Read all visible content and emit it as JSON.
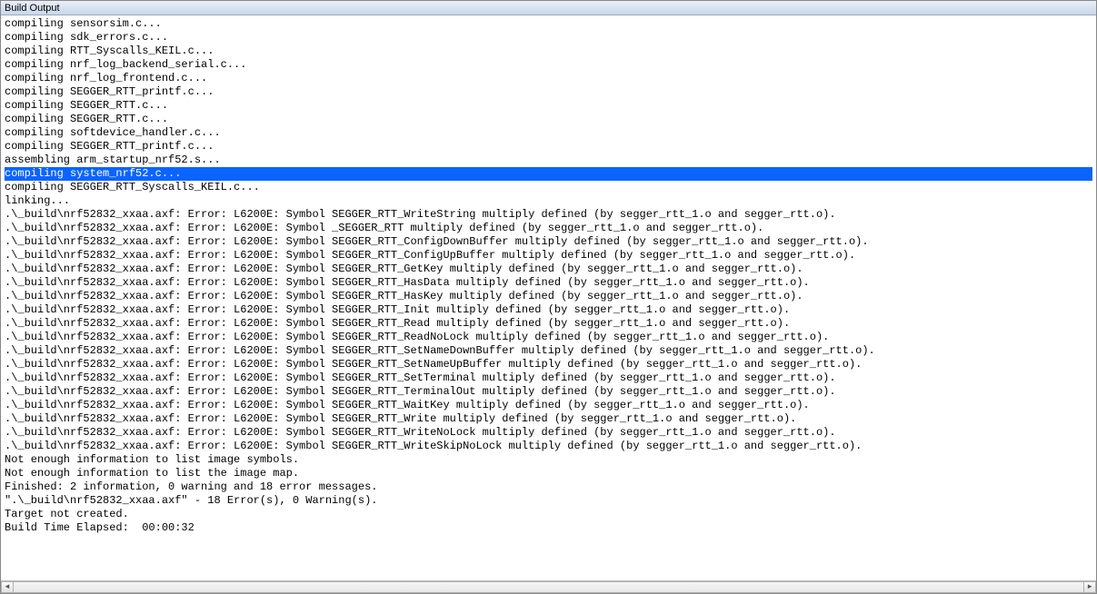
{
  "panel": {
    "title": "Build Output"
  },
  "lines": [
    {
      "text": "compiling sensorsim.c...",
      "selected": false
    },
    {
      "text": "compiling sdk_errors.c...",
      "selected": false
    },
    {
      "text": "compiling RTT_Syscalls_KEIL.c...",
      "selected": false
    },
    {
      "text": "compiling nrf_log_backend_serial.c...",
      "selected": false
    },
    {
      "text": "compiling nrf_log_frontend.c...",
      "selected": false
    },
    {
      "text": "compiling SEGGER_RTT_printf.c...",
      "selected": false
    },
    {
      "text": "compiling SEGGER_RTT.c...",
      "selected": false
    },
    {
      "text": "compiling SEGGER_RTT.c...",
      "selected": false
    },
    {
      "text": "compiling softdevice_handler.c...",
      "selected": false
    },
    {
      "text": "compiling SEGGER_RTT_printf.c...",
      "selected": false
    },
    {
      "text": "assembling arm_startup_nrf52.s...",
      "selected": false
    },
    {
      "text": "compiling system_nrf52.c...",
      "selected": true
    },
    {
      "text": "compiling SEGGER_RTT_Syscalls_KEIL.c...",
      "selected": false
    },
    {
      "text": "linking...",
      "selected": false
    },
    {
      "text": ".\\_build\\nrf52832_xxaa.axf: Error: L6200E: Symbol SEGGER_RTT_WriteString multiply defined (by segger_rtt_1.o and segger_rtt.o).",
      "selected": false
    },
    {
      "text": ".\\_build\\nrf52832_xxaa.axf: Error: L6200E: Symbol _SEGGER_RTT multiply defined (by segger_rtt_1.o and segger_rtt.o).",
      "selected": false
    },
    {
      "text": ".\\_build\\nrf52832_xxaa.axf: Error: L6200E: Symbol SEGGER_RTT_ConfigDownBuffer multiply defined (by segger_rtt_1.o and segger_rtt.o).",
      "selected": false
    },
    {
      "text": ".\\_build\\nrf52832_xxaa.axf: Error: L6200E: Symbol SEGGER_RTT_ConfigUpBuffer multiply defined (by segger_rtt_1.o and segger_rtt.o).",
      "selected": false
    },
    {
      "text": ".\\_build\\nrf52832_xxaa.axf: Error: L6200E: Symbol SEGGER_RTT_GetKey multiply defined (by segger_rtt_1.o and segger_rtt.o).",
      "selected": false
    },
    {
      "text": ".\\_build\\nrf52832_xxaa.axf: Error: L6200E: Symbol SEGGER_RTT_HasData multiply defined (by segger_rtt_1.o and segger_rtt.o).",
      "selected": false
    },
    {
      "text": ".\\_build\\nrf52832_xxaa.axf: Error: L6200E: Symbol SEGGER_RTT_HasKey multiply defined (by segger_rtt_1.o and segger_rtt.o).",
      "selected": false
    },
    {
      "text": ".\\_build\\nrf52832_xxaa.axf: Error: L6200E: Symbol SEGGER_RTT_Init multiply defined (by segger_rtt_1.o and segger_rtt.o).",
      "selected": false
    },
    {
      "text": ".\\_build\\nrf52832_xxaa.axf: Error: L6200E: Symbol SEGGER_RTT_Read multiply defined (by segger_rtt_1.o and segger_rtt.o).",
      "selected": false
    },
    {
      "text": ".\\_build\\nrf52832_xxaa.axf: Error: L6200E: Symbol SEGGER_RTT_ReadNoLock multiply defined (by segger_rtt_1.o and segger_rtt.o).",
      "selected": false
    },
    {
      "text": ".\\_build\\nrf52832_xxaa.axf: Error: L6200E: Symbol SEGGER_RTT_SetNameDownBuffer multiply defined (by segger_rtt_1.o and segger_rtt.o).",
      "selected": false
    },
    {
      "text": ".\\_build\\nrf52832_xxaa.axf: Error: L6200E: Symbol SEGGER_RTT_SetNameUpBuffer multiply defined (by segger_rtt_1.o and segger_rtt.o).",
      "selected": false
    },
    {
      "text": ".\\_build\\nrf52832_xxaa.axf: Error: L6200E: Symbol SEGGER_RTT_SetTerminal multiply defined (by segger_rtt_1.o and segger_rtt.o).",
      "selected": false
    },
    {
      "text": ".\\_build\\nrf52832_xxaa.axf: Error: L6200E: Symbol SEGGER_RTT_TerminalOut multiply defined (by segger_rtt_1.o and segger_rtt.o).",
      "selected": false
    },
    {
      "text": ".\\_build\\nrf52832_xxaa.axf: Error: L6200E: Symbol SEGGER_RTT_WaitKey multiply defined (by segger_rtt_1.o and segger_rtt.o).",
      "selected": false
    },
    {
      "text": ".\\_build\\nrf52832_xxaa.axf: Error: L6200E: Symbol SEGGER_RTT_Write multiply defined (by segger_rtt_1.o and segger_rtt.o).",
      "selected": false
    },
    {
      "text": ".\\_build\\nrf52832_xxaa.axf: Error: L6200E: Symbol SEGGER_RTT_WriteNoLock multiply defined (by segger_rtt_1.o and segger_rtt.o).",
      "selected": false
    },
    {
      "text": ".\\_build\\nrf52832_xxaa.axf: Error: L6200E: Symbol SEGGER_RTT_WriteSkipNoLock multiply defined (by segger_rtt_1.o and segger_rtt.o).",
      "selected": false
    },
    {
      "text": "Not enough information to list image symbols.",
      "selected": false
    },
    {
      "text": "Not enough information to list the image map.",
      "selected": false
    },
    {
      "text": "Finished: 2 information, 0 warning and 18 error messages.",
      "selected": false
    },
    {
      "text": "\".\\_build\\nrf52832_xxaa.axf\" - 18 Error(s), 0 Warning(s).",
      "selected": false
    },
    {
      "text": "Target not created.",
      "selected": false
    },
    {
      "text": "Build Time Elapsed:  00:00:32",
      "selected": false
    }
  ]
}
